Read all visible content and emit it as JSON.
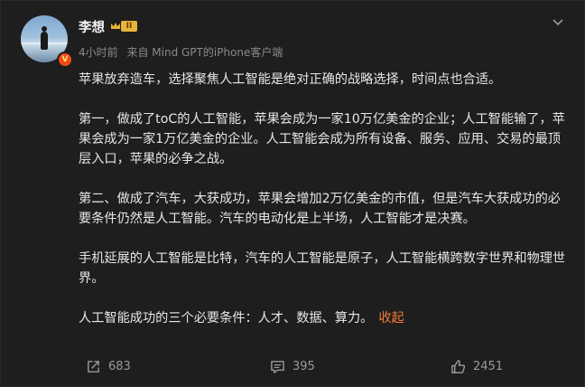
{
  "author": {
    "name": "李想",
    "vip_level": "II",
    "verified_mark": "V"
  },
  "meta": {
    "time": "4小时前",
    "source": "来自 Mind GPT的iPhone客户端"
  },
  "post": {
    "paragraphs": [
      "苹果放弃造车，选择聚焦人工智能是绝对正确的战略选择，时间点也合适。",
      "第一，做成了toC的人工智能，苹果会成为一家10万亿美金的企业；人工智能输了，苹果会成为一家1万亿美金的企业。人工智能会成为所有设备、服务、应用、交易的最顶层入口，苹果的必争之战。",
      "第二、做成了汽车，大获成功，苹果会增加2万亿美金的市值，但是汽车大获成功的必要条件仍然是人工智能。汽车的电动化是上半场，人工智能才是决赛。",
      "手机延展的人工智能是比特，汽车的人工智能是原子，人工智能横跨数字世界和物理世界。",
      "人工智能成功的三个必要条件：人才、数据、算力。"
    ],
    "collapse_label": "收起"
  },
  "actions": {
    "repost_count": "683",
    "comment_count": "395",
    "like_count": "2451"
  },
  "icons": {
    "more": "chevron-down-icon",
    "repost": "share-icon",
    "comment": "comment-icon",
    "like": "thumbs-up-icon"
  },
  "colors": {
    "background": "#1e1e1e",
    "text": "#e6e6e6",
    "meta": "#8a8a8a",
    "link": "#f07a3c",
    "verified": "#f04a1a"
  }
}
